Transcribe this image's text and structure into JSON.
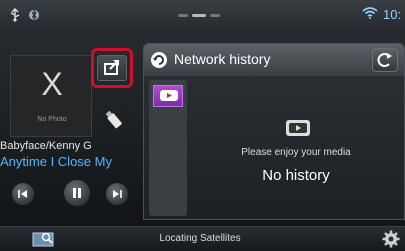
{
  "status_bar": {
    "time": "10:",
    "icons": [
      "usb-icon",
      "bluetooth-icon",
      "wifi-icon"
    ],
    "page_indicator": {
      "pages": 3,
      "active": 2
    }
  },
  "source": {
    "album_art_placeholder": "X",
    "no_photo_label": "No Photo",
    "artist": "Babyface/Kenny G",
    "track": "Anytime I Close My",
    "controls": [
      "previous-icon",
      "play-pause-icon",
      "next-icon"
    ],
    "share_button_icon": "export-icon",
    "source_icon": "usb-stick-icon"
  },
  "panel": {
    "title": "Network history",
    "title_icon": "refresh-icon",
    "reload_icon": "reload-icon",
    "sidebar_tile_logo": "youtube-logo",
    "center_logo": "youtube-logo",
    "message": "Please enjoy your media",
    "empty_text": "No history"
  },
  "bottom_bar": {
    "gps_status": "Locating Satellites",
    "nav_icon": "navigation-icon",
    "settings_icon": "gear-icon"
  },
  "colors": {
    "highlight": "#d0102a",
    "track_text": "#4fb8ff",
    "youtube_tile": "#9a3ec0"
  }
}
